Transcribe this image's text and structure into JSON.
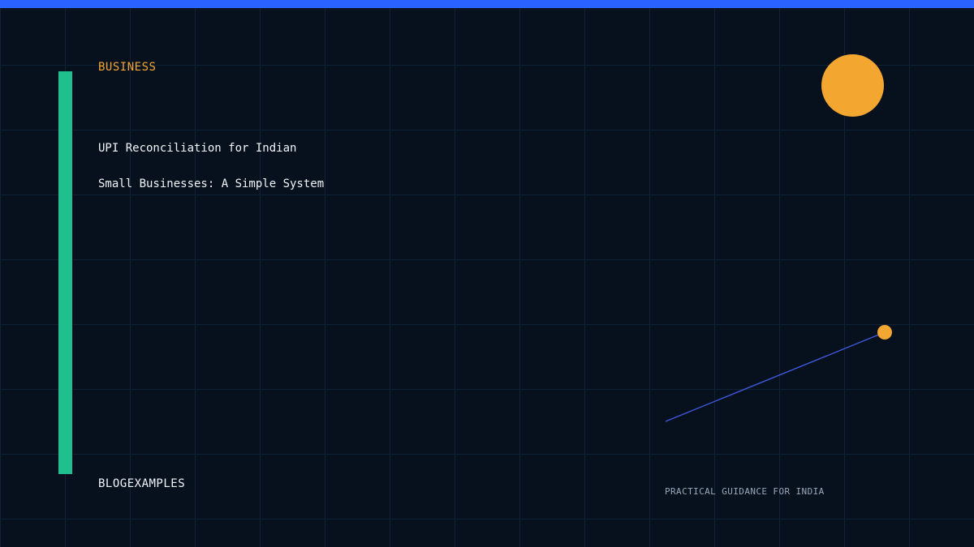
{
  "card": {
    "category": "BUSINESS",
    "title_lines": [
      "UPI Reconciliation for Indian",
      "Small Businesses: A Simple System"
    ],
    "brand": "BLOGEXAMPLES",
    "tagline": "PRACTICAL GUIDANCE FOR INDIA"
  },
  "colors": {
    "background": "#07111e",
    "grid": "#0f2236",
    "top_bar": "#2962ff",
    "accent_bar": "#1fc08e",
    "orange": "#f3a630",
    "line": "#3f5ae0",
    "text": "#f2f5f8",
    "muted_text": "#9aa8bb"
  }
}
